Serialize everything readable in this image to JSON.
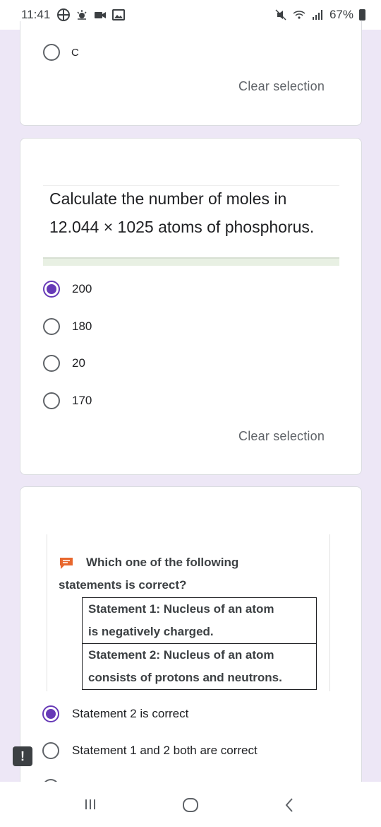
{
  "status_bar": {
    "time": "11:41",
    "battery": "67%",
    "left_icons": [
      "settings-icon",
      "weather-icon",
      "video-icon",
      "image-icon"
    ],
    "right_icons": [
      "mute-icon",
      "wifi-icon",
      "signal-icon",
      "battery-icon"
    ]
  },
  "cards": {
    "top": {
      "option_label": "C",
      "clear_label": "Clear selection"
    },
    "middle": {
      "question_line1": "Calculate the number of moles in",
      "question_line2": "12.044 × 1025 atoms of phosphorus.",
      "options": [
        "200",
        "180",
        "20",
        "170"
      ],
      "selected_index": 0,
      "clear_label": "Clear selection"
    },
    "bottom": {
      "question_line1": "Which one of the following",
      "question_line2": "statements is correct?",
      "statements": [
        {
          "line1": "Statement 1: Nucleus of an atom",
          "line2": "is negatively charged."
        },
        {
          "line1": "Statement 2: Nucleus of an atom",
          "line2": "consists of protons and neutrons."
        }
      ],
      "options": [
        "Statement 2 is correct",
        "Statement 1 and 2 both are correct"
      ],
      "selected_index": 0
    }
  },
  "feedback_label": "!",
  "colors": {
    "accent": "#673ab7",
    "background": "#ede7f6"
  }
}
